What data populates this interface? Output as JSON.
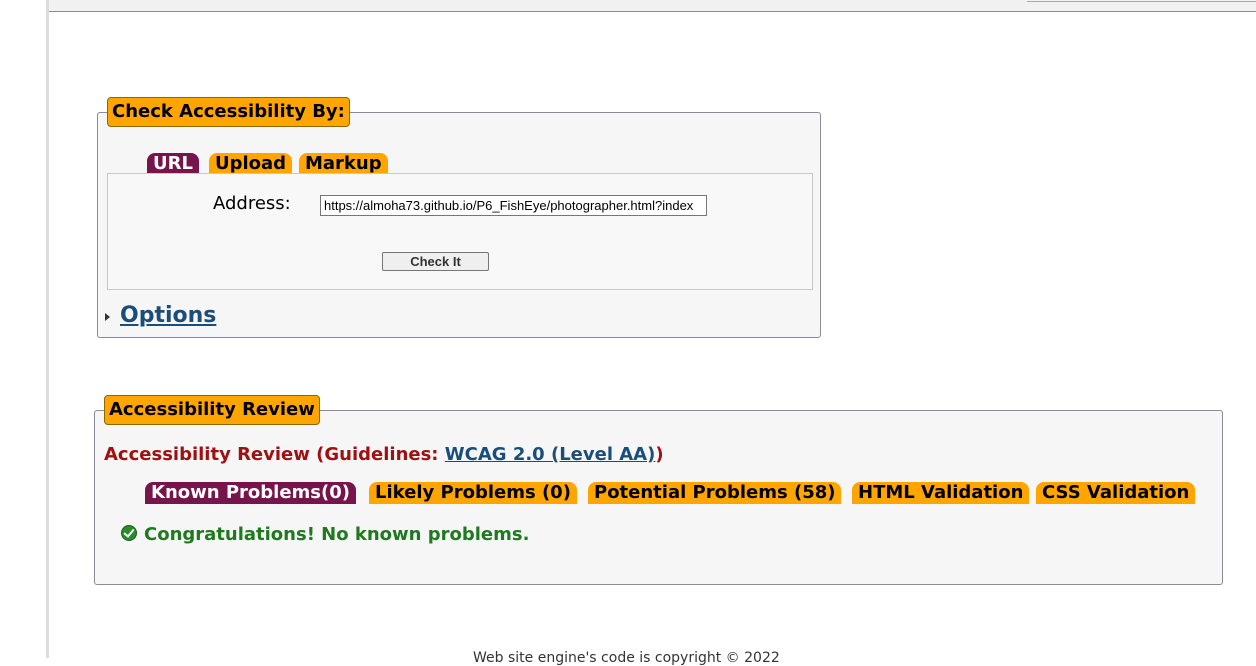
{
  "check_panel": {
    "legend": "Check Accessibility By:",
    "tabs": [
      {
        "label": "URL",
        "active": true
      },
      {
        "label": "Upload",
        "active": false
      },
      {
        "label": "Markup",
        "active": false
      }
    ],
    "address_label": "Address:",
    "address_value": "https://almoha73.github.io/P6_FishEye/photographer.html?index",
    "check_button": "Check It",
    "options_link": "Options"
  },
  "review_panel": {
    "legend": "Accessibility Review",
    "heading_prefix": "Accessibility Review (Guidelines: ",
    "guideline_link": "WCAG 2.0 (Level AA)",
    "heading_suffix": ")",
    "tabs": [
      {
        "label": "Known Problems(0)",
        "active": true
      },
      {
        "label": "Likely Problems (0)",
        "active": false
      },
      {
        "label": "Potential Problems (58)",
        "active": false
      },
      {
        "label": "HTML Validation",
        "active": false
      },
      {
        "label": "CSS Validation",
        "active": false
      }
    ],
    "result_message": "Congratulations! No known problems."
  },
  "footer": {
    "text": "Web site engine's code is copyright © 2022"
  },
  "colors": {
    "accent_orange": "#ffa500",
    "active_tab": "#78144c",
    "link": "#1a4e7a",
    "error_red": "#a01010",
    "success_green": "#1f7a1f"
  },
  "icons": {
    "options_toggle": "triangle-right-icon",
    "result": "check-circle-icon"
  }
}
